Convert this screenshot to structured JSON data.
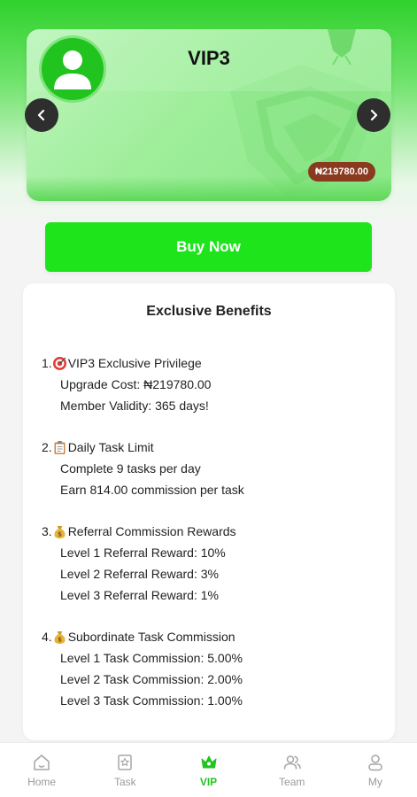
{
  "card": {
    "title": "VIP3",
    "price": "₦219780.00"
  },
  "buy_button": "Buy Now",
  "benefits": {
    "title": "Exclusive Benefits",
    "items": [
      {
        "heading": "VIP3 Exclusive Privilege",
        "number": "1.",
        "icon": "target-icon",
        "lines": [
          "Upgrade Cost: ₦219780.00",
          "Member Validity: 365 days!"
        ]
      },
      {
        "heading": "Daily Task Limit",
        "number": "2.",
        "icon": "clipboard-icon",
        "lines": [
          "Complete 9 tasks per day",
          "Earn 814.00 commission per task"
        ]
      },
      {
        "heading": "Referral Commission Rewards",
        "number": "3.",
        "icon": "money-bag-icon",
        "lines": [
          "Level 1 Referral Reward: 10%",
          "Level 2 Referral Reward: 3%",
          "Level 3 Referral Reward: 1%"
        ]
      },
      {
        "heading": "Subordinate Task Commission",
        "number": "4.",
        "icon": "money-bag-icon",
        "lines": [
          "Level 1 Task Commission: 5.00%",
          "Level 2 Task Commission: 2.00%",
          "Level 3 Task Commission: 1.00%"
        ]
      }
    ]
  },
  "tabs": [
    {
      "label": "Home",
      "icon": "home-icon"
    },
    {
      "label": "Task",
      "icon": "task-icon"
    },
    {
      "label": "VIP",
      "icon": "crown-icon",
      "active": true
    },
    {
      "label": "Team",
      "icon": "team-icon"
    },
    {
      "label": "My",
      "icon": "user-icon"
    }
  ],
  "colors": {
    "accent": "#1ee51b",
    "active_tab": "#22c41f",
    "price_badge": "#8a3a1e"
  }
}
